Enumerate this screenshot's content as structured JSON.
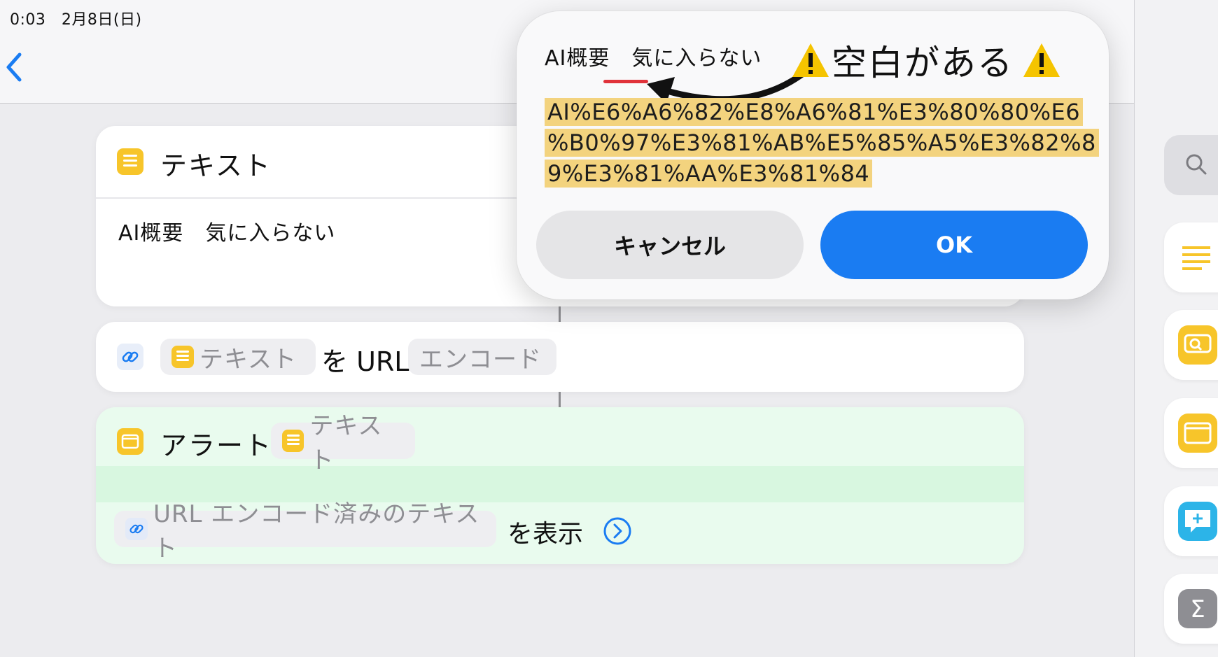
{
  "status_bar": {
    "time": "0:03　2月8日(日)"
  },
  "colors": {
    "accent": "#1a7cf2",
    "yellow": "#f7c52a",
    "highlight": "#f3d37e",
    "red_underline": "#e0323a"
  },
  "text_action": {
    "title": "テキスト",
    "body": "AI概要　気に入らない",
    "icon": "text-doc-icon"
  },
  "url_action": {
    "var_label": "テキスト",
    "mid_text": "を URL",
    "mode": "エンコード",
    "icon": "link-icon"
  },
  "alert_action": {
    "title": "アラート",
    "var_label": "テキスト",
    "result_label": "URL エンコード済みのテキスト",
    "show_text": "を表示",
    "icon": "alert-window-icon"
  },
  "dialog": {
    "title": "AI概要　気に入らない",
    "annotation": "空白がある",
    "encoded_lines": [
      "AI%E6%A6%82%E8%A6%81%E3%80%80%E6",
      "%B0%97%E3%81%AB%E5%85%A5%E3%82%8",
      "9%E3%81%AA%E3%81%84"
    ],
    "cancel_label": "キャンセル",
    "ok_label": "OK"
  },
  "sidebar_icons": [
    "search-icon",
    "text-icon",
    "speak-text-icon",
    "alert-icon",
    "comment-icon",
    "sum-icon"
  ]
}
